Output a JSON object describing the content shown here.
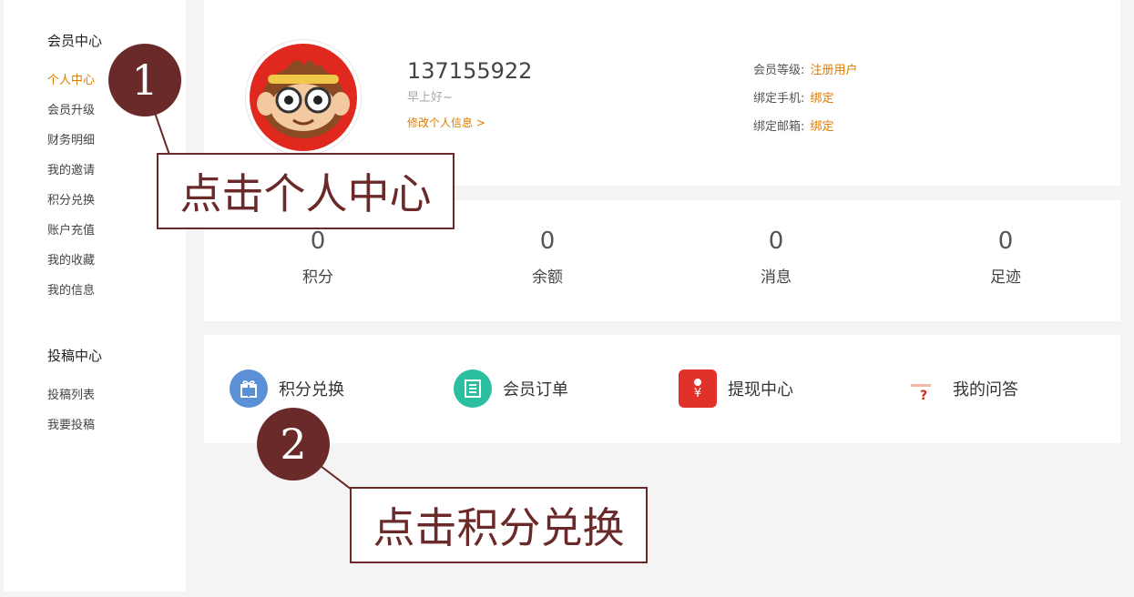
{
  "sidebar": {
    "group1_title": "会员中心",
    "group1_items": [
      "个人中心",
      "会员升级",
      "财务明细",
      "我的邀请",
      "积分兑换",
      "账户充值",
      "我的收藏",
      "我的信息"
    ],
    "group2_title": "投稿中心",
    "group2_items": [
      "投稿列表",
      "我要投稿"
    ]
  },
  "profile": {
    "username": "137155922",
    "greeting": "早上好~",
    "edit_link": "修改个人信息 >",
    "level_label": "会员等级:",
    "level_value": "注册用户",
    "phone_label": "绑定手机:",
    "phone_value": "绑定",
    "email_label": "绑定邮箱:",
    "email_value": "绑定"
  },
  "stats": [
    {
      "value": "0",
      "label": "积分"
    },
    {
      "value": "0",
      "label": "余额"
    },
    {
      "value": "0",
      "label": "消息"
    },
    {
      "value": "0",
      "label": "足迹"
    }
  ],
  "shortcuts": [
    {
      "label": "积分兑换",
      "icon": "gift-icon",
      "color": "#5b8fd6"
    },
    {
      "label": "会员订单",
      "icon": "order-list-icon",
      "color": "#2bbf9f"
    },
    {
      "label": "提现中心",
      "icon": "withdraw-icon",
      "color": "#e0322a"
    },
    {
      "label": "我的问答",
      "icon": "qa-icon",
      "color": "#e0322a"
    }
  ],
  "annotations": {
    "step1_number": "1",
    "step1_text": "点击个人中心",
    "step2_number": "2",
    "step2_text": "点击积分兑换"
  },
  "colors": {
    "accent": "#e07b00",
    "annotation": "#6b2a2a"
  }
}
